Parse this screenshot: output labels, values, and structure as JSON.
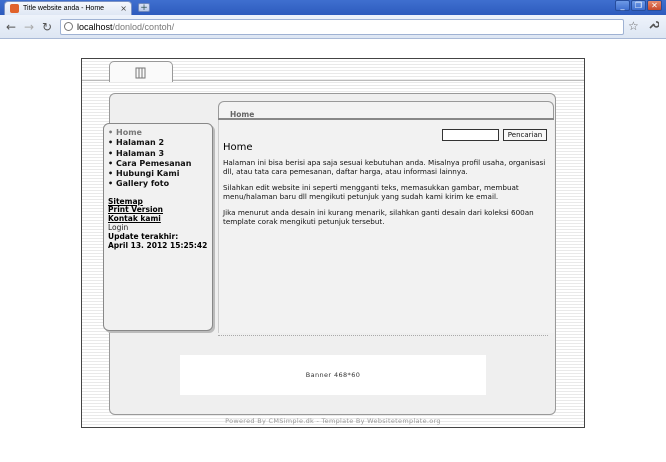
{
  "browser": {
    "tab_title": "Title website anda - Home",
    "tab_close": "×",
    "new_tab": "+",
    "window_buttons": [
      "_",
      "❐",
      "✕"
    ],
    "back_icon": "←",
    "forward_icon": "→",
    "reload_icon": "↻",
    "url_host": "localhost",
    "url_path": "/donlod/contoh/",
    "bookmark_icon": "☆",
    "wrench_icon": "🔧"
  },
  "sidebar": {
    "menu": [
      {
        "label": "Home",
        "active": true
      },
      {
        "label": "Halaman 2",
        "active": false
      },
      {
        "label": "Halaman 3",
        "active": false
      },
      {
        "label": "Cara Pemesanan",
        "active": false
      },
      {
        "label": "Hubungi Kami",
        "active": false
      },
      {
        "label": "Gallery foto",
        "active": false
      }
    ],
    "links": {
      "sitemap": "Sitemap",
      "print_version": "Print Version",
      "contact": "Kontak kami",
      "login": "Login",
      "update_label": "Update terakhir:",
      "update_date": "April 13. 2012 15:25:42"
    }
  },
  "content": {
    "breadcrumb": "Home",
    "search_value": "",
    "search_button": "Pencarian",
    "title": "Home",
    "paragraphs": [
      "Halaman ini bisa berisi apa saja sesuai kebutuhan anda. Misalnya profil usaha, organisasi dll, atau tata cara pemesanan, daftar harga, atau informasi lainnya.",
      "Silahkan edit website ini seperti mengganti teks, memasukkan gambar, membuat menu/halaman baru dll mengikuti petunjuk yang sudah kami kirim ke email.",
      "Jika menurut anda desain ini kurang menarik, silahkan ganti desain dari koleksi 600an template corak mengikuti petunjuk tersebut."
    ]
  },
  "banner": {
    "text": "Banner 468*60"
  },
  "footer": {
    "text": "Powered By CMSimple.dk - Template By Websitetemplate.org"
  }
}
